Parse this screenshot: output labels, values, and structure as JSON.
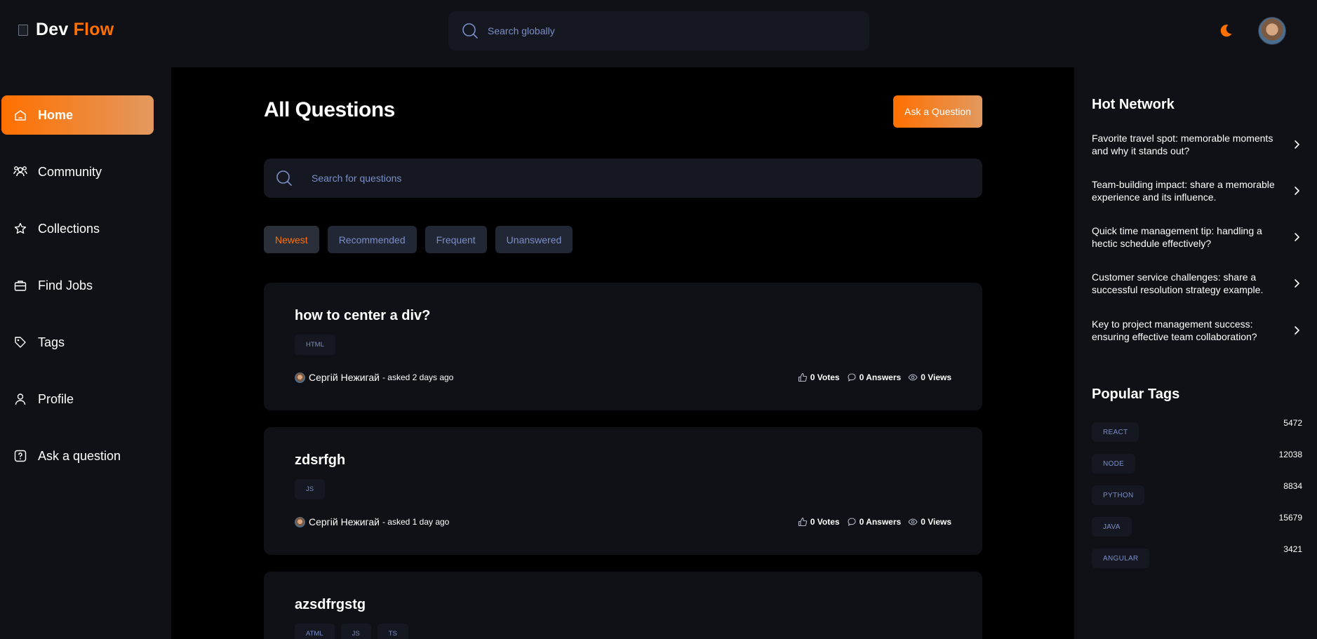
{
  "header": {
    "logo_primary": "Dev",
    "logo_accent": "Flow",
    "search_placeholder": "Search globally",
    "theme_icon": "moon-icon",
    "accent_color": "#ff7000"
  },
  "sidebar": {
    "items": [
      {
        "label": "Home",
        "icon": "home-icon",
        "active": true
      },
      {
        "label": "Community",
        "icon": "users-icon",
        "active": false
      },
      {
        "label": "Collections",
        "icon": "star-icon",
        "active": false
      },
      {
        "label": "Find Jobs",
        "icon": "suitcase-icon",
        "active": false
      },
      {
        "label": "Tags",
        "icon": "tag-icon",
        "active": false
      },
      {
        "label": "Profile",
        "icon": "user-icon",
        "active": false
      },
      {
        "label": "Ask a question",
        "icon": "question-icon",
        "active": false
      }
    ]
  },
  "main": {
    "title": "All Questions",
    "ask_button": "Ask a Question",
    "search_placeholder": "Search for questions",
    "filters": [
      {
        "label": "Newest",
        "active": true
      },
      {
        "label": "Recommended",
        "active": false
      },
      {
        "label": "Frequent",
        "active": false
      },
      {
        "label": "Unanswered",
        "active": false
      }
    ],
    "questions": [
      {
        "title": "how to center a div?",
        "tags": [
          "HTML"
        ],
        "author": "Сергій Нежигай",
        "asked": "- asked 2 days ago",
        "votes": "0 Votes",
        "answers": "0 Answers",
        "views": "0 Views"
      },
      {
        "title": "zdsrfgh",
        "tags": [
          "JS"
        ],
        "author": "Сергій Нежигай",
        "asked": "- asked 1 day ago",
        "votes": "0 Votes",
        "answers": "0 Answers",
        "views": "0 Views"
      },
      {
        "title": "azsdfrgstg",
        "tags": [
          "ATML",
          "JS",
          "TS"
        ],
        "author": "",
        "asked": "",
        "votes": "",
        "answers": "",
        "views": ""
      }
    ]
  },
  "rightbar": {
    "hot_title": "Hot Network",
    "hot_items": [
      "Favorite travel spot: memorable moments and why it stands out?",
      "Team-building impact: share a memorable experience and its influence.",
      "Quick time management tip: handling a hectic schedule effectively?",
      "Customer service challenges: share a successful resolution strategy example.",
      "Key to project management success: ensuring effective team collaboration?"
    ],
    "tags_title": "Popular Tags",
    "tags": [
      {
        "name": "REACT",
        "count": "5472"
      },
      {
        "name": "NODE",
        "count": "12038"
      },
      {
        "name": "PYTHON",
        "count": "8834"
      },
      {
        "name": "JAVA",
        "count": "15679"
      },
      {
        "name": "ANGULAR",
        "count": "3421"
      }
    ]
  }
}
